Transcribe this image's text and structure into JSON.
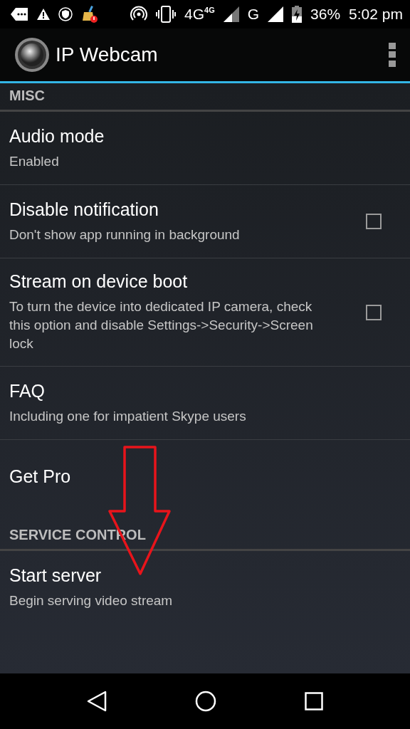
{
  "status_bar": {
    "network": "4G",
    "network_small": "4G",
    "network2": "G",
    "battery": "36%",
    "time": "5:02 pm"
  },
  "app_bar": {
    "title": "IP Webcam"
  },
  "sections": [
    {
      "title": "MISC",
      "items": [
        {
          "kind": "plain",
          "title": "Audio mode",
          "summary": "Enabled"
        },
        {
          "kind": "checkbox",
          "title": "Disable notification",
          "summary": "Don't show app running in background",
          "checked": false
        },
        {
          "kind": "checkbox",
          "title": "Stream on device boot",
          "summary": "To turn the device into dedicated IP camera, check this option and disable Settings->Security->Screen lock",
          "checked": false
        },
        {
          "kind": "plain",
          "title": "FAQ",
          "summary": "Including one for impatient Skype users"
        },
        {
          "kind": "plain",
          "title": "Get Pro"
        }
      ]
    },
    {
      "title": "SERVICE CONTROL",
      "items": [
        {
          "kind": "plain",
          "title": "Start server",
          "summary": "Begin serving video stream"
        }
      ]
    }
  ]
}
